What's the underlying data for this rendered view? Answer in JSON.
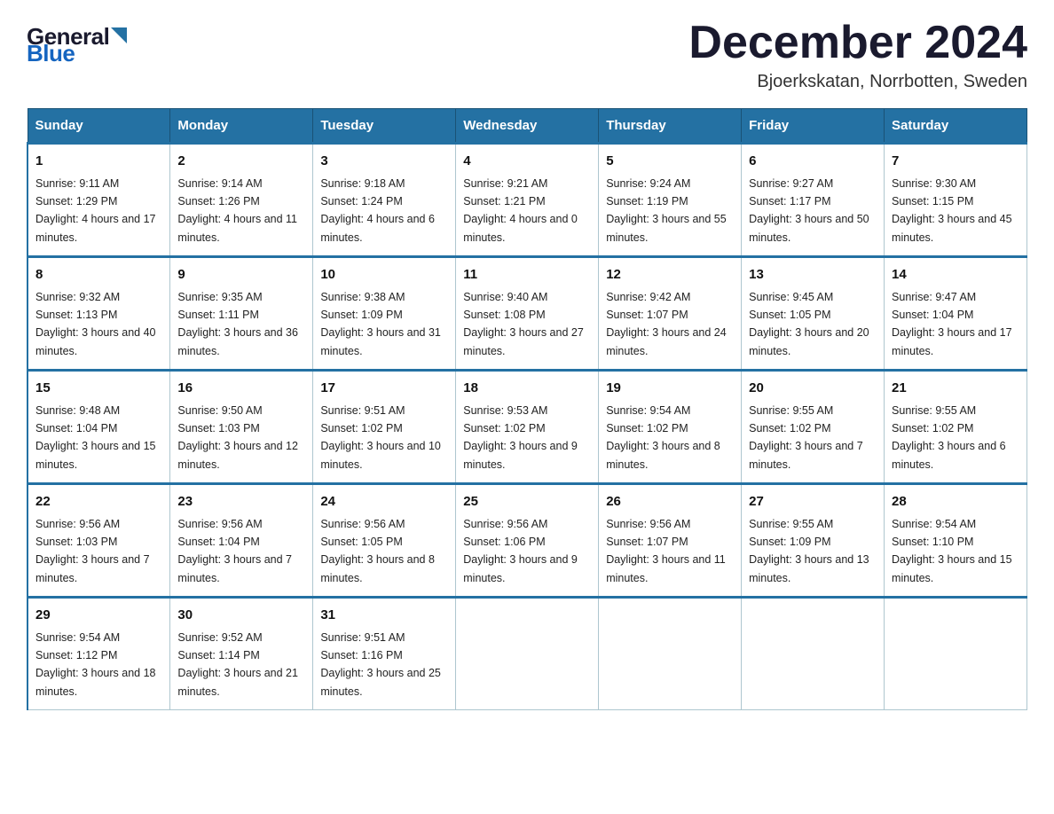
{
  "header": {
    "logo_general": "General",
    "logo_blue": "Blue",
    "month_title": "December 2024",
    "location": "Bjoerkskatan, Norrbotten, Sweden"
  },
  "days_of_week": [
    "Sunday",
    "Monday",
    "Tuesday",
    "Wednesday",
    "Thursday",
    "Friday",
    "Saturday"
  ],
  "weeks": [
    [
      {
        "day": "1",
        "sunrise": "9:11 AM",
        "sunset": "1:29 PM",
        "daylight": "4 hours and 17 minutes."
      },
      {
        "day": "2",
        "sunrise": "9:14 AM",
        "sunset": "1:26 PM",
        "daylight": "4 hours and 11 minutes."
      },
      {
        "day": "3",
        "sunrise": "9:18 AM",
        "sunset": "1:24 PM",
        "daylight": "4 hours and 6 minutes."
      },
      {
        "day": "4",
        "sunrise": "9:21 AM",
        "sunset": "1:21 PM",
        "daylight": "4 hours and 0 minutes."
      },
      {
        "day": "5",
        "sunrise": "9:24 AM",
        "sunset": "1:19 PM",
        "daylight": "3 hours and 55 minutes."
      },
      {
        "day": "6",
        "sunrise": "9:27 AM",
        "sunset": "1:17 PM",
        "daylight": "3 hours and 50 minutes."
      },
      {
        "day": "7",
        "sunrise": "9:30 AM",
        "sunset": "1:15 PM",
        "daylight": "3 hours and 45 minutes."
      }
    ],
    [
      {
        "day": "8",
        "sunrise": "9:32 AM",
        "sunset": "1:13 PM",
        "daylight": "3 hours and 40 minutes."
      },
      {
        "day": "9",
        "sunrise": "9:35 AM",
        "sunset": "1:11 PM",
        "daylight": "3 hours and 36 minutes."
      },
      {
        "day": "10",
        "sunrise": "9:38 AM",
        "sunset": "1:09 PM",
        "daylight": "3 hours and 31 minutes."
      },
      {
        "day": "11",
        "sunrise": "9:40 AM",
        "sunset": "1:08 PM",
        "daylight": "3 hours and 27 minutes."
      },
      {
        "day": "12",
        "sunrise": "9:42 AM",
        "sunset": "1:07 PM",
        "daylight": "3 hours and 24 minutes."
      },
      {
        "day": "13",
        "sunrise": "9:45 AM",
        "sunset": "1:05 PM",
        "daylight": "3 hours and 20 minutes."
      },
      {
        "day": "14",
        "sunrise": "9:47 AM",
        "sunset": "1:04 PM",
        "daylight": "3 hours and 17 minutes."
      }
    ],
    [
      {
        "day": "15",
        "sunrise": "9:48 AM",
        "sunset": "1:04 PM",
        "daylight": "3 hours and 15 minutes."
      },
      {
        "day": "16",
        "sunrise": "9:50 AM",
        "sunset": "1:03 PM",
        "daylight": "3 hours and 12 minutes."
      },
      {
        "day": "17",
        "sunrise": "9:51 AM",
        "sunset": "1:02 PM",
        "daylight": "3 hours and 10 minutes."
      },
      {
        "day": "18",
        "sunrise": "9:53 AM",
        "sunset": "1:02 PM",
        "daylight": "3 hours and 9 minutes."
      },
      {
        "day": "19",
        "sunrise": "9:54 AM",
        "sunset": "1:02 PM",
        "daylight": "3 hours and 8 minutes."
      },
      {
        "day": "20",
        "sunrise": "9:55 AM",
        "sunset": "1:02 PM",
        "daylight": "3 hours and 7 minutes."
      },
      {
        "day": "21",
        "sunrise": "9:55 AM",
        "sunset": "1:02 PM",
        "daylight": "3 hours and 6 minutes."
      }
    ],
    [
      {
        "day": "22",
        "sunrise": "9:56 AM",
        "sunset": "1:03 PM",
        "daylight": "3 hours and 7 minutes."
      },
      {
        "day": "23",
        "sunrise": "9:56 AM",
        "sunset": "1:04 PM",
        "daylight": "3 hours and 7 minutes."
      },
      {
        "day": "24",
        "sunrise": "9:56 AM",
        "sunset": "1:05 PM",
        "daylight": "3 hours and 8 minutes."
      },
      {
        "day": "25",
        "sunrise": "9:56 AM",
        "sunset": "1:06 PM",
        "daylight": "3 hours and 9 minutes."
      },
      {
        "day": "26",
        "sunrise": "9:56 AM",
        "sunset": "1:07 PM",
        "daylight": "3 hours and 11 minutes."
      },
      {
        "day": "27",
        "sunrise": "9:55 AM",
        "sunset": "1:09 PM",
        "daylight": "3 hours and 13 minutes."
      },
      {
        "day": "28",
        "sunrise": "9:54 AM",
        "sunset": "1:10 PM",
        "daylight": "3 hours and 15 minutes."
      }
    ],
    [
      {
        "day": "29",
        "sunrise": "9:54 AM",
        "sunset": "1:12 PM",
        "daylight": "3 hours and 18 minutes."
      },
      {
        "day": "30",
        "sunrise": "9:52 AM",
        "sunset": "1:14 PM",
        "daylight": "3 hours and 21 minutes."
      },
      {
        "day": "31",
        "sunrise": "9:51 AM",
        "sunset": "1:16 PM",
        "daylight": "3 hours and 25 minutes."
      },
      null,
      null,
      null,
      null
    ]
  ],
  "labels": {
    "sunrise": "Sunrise:",
    "sunset": "Sunset:",
    "daylight": "Daylight:"
  }
}
